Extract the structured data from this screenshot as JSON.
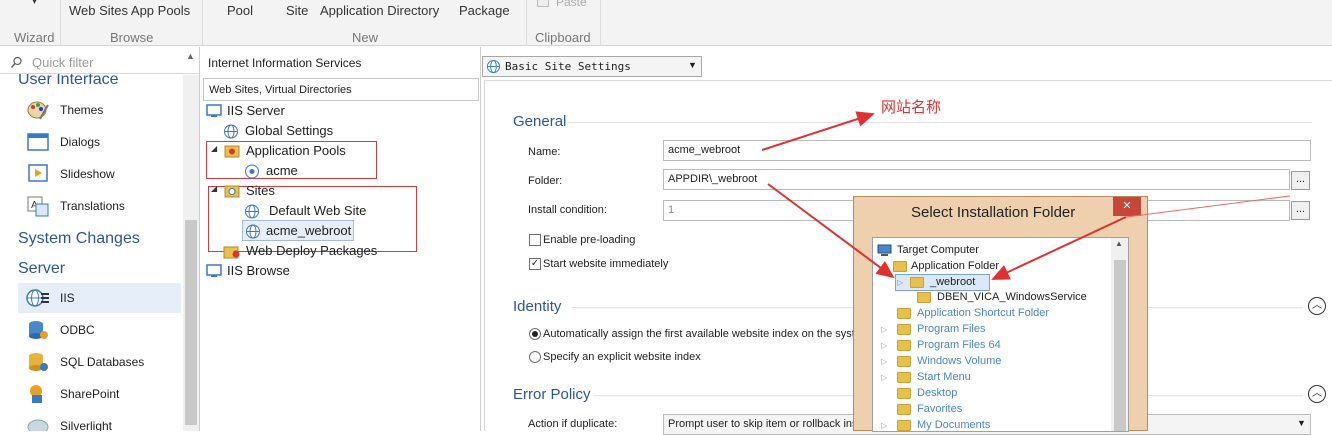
{
  "ribbon": {
    "wizard_label": "Wizard",
    "web_sites_app_pools": "Web Sites App Pools",
    "browse_label": "Browse",
    "pool": "Pool",
    "site": "Site",
    "application_directory": "Application Directory",
    "package": "Package",
    "new_label": "New",
    "paste": "Paste",
    "clipboard_label": "Clipboard"
  },
  "left": {
    "quick_filter_placeholder": "Quick filter",
    "section_user_interface": "User Interface",
    "items_ui": [
      "Themes",
      "Dialogs",
      "Slideshow",
      "Translations"
    ],
    "section_system_changes": "System Changes",
    "section_server": "Server",
    "items_server": [
      "IIS",
      "ODBC",
      "SQL Databases",
      "SharePoint",
      "Silverlight"
    ]
  },
  "tree": {
    "header": "Internet Information Services",
    "subheader": "Web Sites, Virtual Directories",
    "iis_server": "IIS Server",
    "global_settings": "Global Settings",
    "application_pools": "Application Pools",
    "acme": "acme",
    "sites": "Sites",
    "default_web_site": "Default Web Site",
    "acme_webroot": "acme_webroot",
    "web_deploy_packages": "Web Deploy Packages",
    "iis_browse": "IIS Browse"
  },
  "main": {
    "view_select": "Basic Site Settings",
    "general": "General",
    "name_label": "Name:",
    "name_value": "acme_webroot",
    "folder_label": "Folder:",
    "folder_value": "APPDIR\\_webroot",
    "install_condition_label": "Install condition:",
    "install_condition_value": "1",
    "enable_preloading": "Enable pre-loading",
    "start_website": "Start website immediately",
    "identity": "Identity",
    "auto_assign": "Automatically assign the first available website index on the syst",
    "specify_index": "Specify an explicit website index",
    "error_policy": "Error Policy",
    "action_if_duplicate_label": "Action if duplicate:",
    "action_if_duplicate_value": "Prompt user to skip item or rollback inst",
    "browse_button": "...",
    "annotation": "网站名称"
  },
  "dialog": {
    "title": "Select Installation Folder",
    "close": "✕",
    "target_computer": "Target Computer",
    "application_folder": "Application Folder",
    "webroot": "_webroot",
    "dben_service": "DBEN_VICA_WindowsService",
    "others": [
      "Application Shortcut Folder",
      "Program Files",
      "Program Files 64",
      "Windows Volume",
      "Start Menu",
      "Desktop",
      "Favorites",
      "My Documents"
    ]
  },
  "colors": {
    "accent": "#2b5797",
    "annotation_red": "#e03131",
    "link_blue": "#4a86c8"
  }
}
